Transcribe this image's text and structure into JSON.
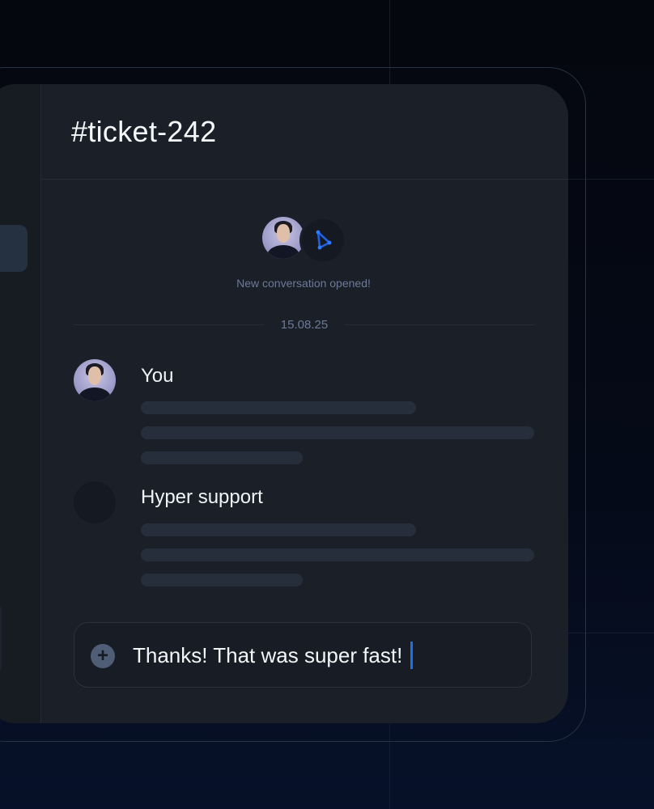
{
  "ticket": {
    "title": "#ticket-242"
  },
  "conversation": {
    "opened_message": "New conversation opened!",
    "date": "15.08.25"
  },
  "messages": [
    {
      "sender": "You",
      "avatar": "user-photo"
    },
    {
      "sender": "Hyper support",
      "avatar": "bot-avatar"
    }
  ],
  "composer": {
    "value": "Thanks! That was super fast!",
    "add_icon": "plus-icon"
  },
  "colors": {
    "background": "#05070e",
    "card": "#1b2028",
    "accent": "#1f6fe8",
    "muted_text": "#6b7a96"
  }
}
